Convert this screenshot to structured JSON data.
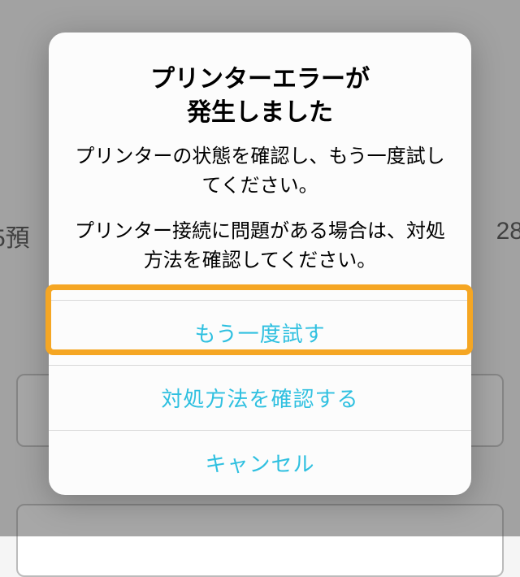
{
  "background": {
    "left_text": "5預",
    "right_text": "28",
    "button1_label": "",
    "button2_label": ""
  },
  "dialog": {
    "title_line1": "プリンターエラーが",
    "title_line2": "発生しました",
    "message_line1": "プリンターの状態を確認し、もう一度試してください。",
    "message_line2": "プリンター接続に問題がある場合は、対処方法を確認してください。",
    "buttons": {
      "retry": "もう一度試す",
      "check_solution": "対処方法を確認する",
      "cancel": "キャンセル"
    }
  }
}
